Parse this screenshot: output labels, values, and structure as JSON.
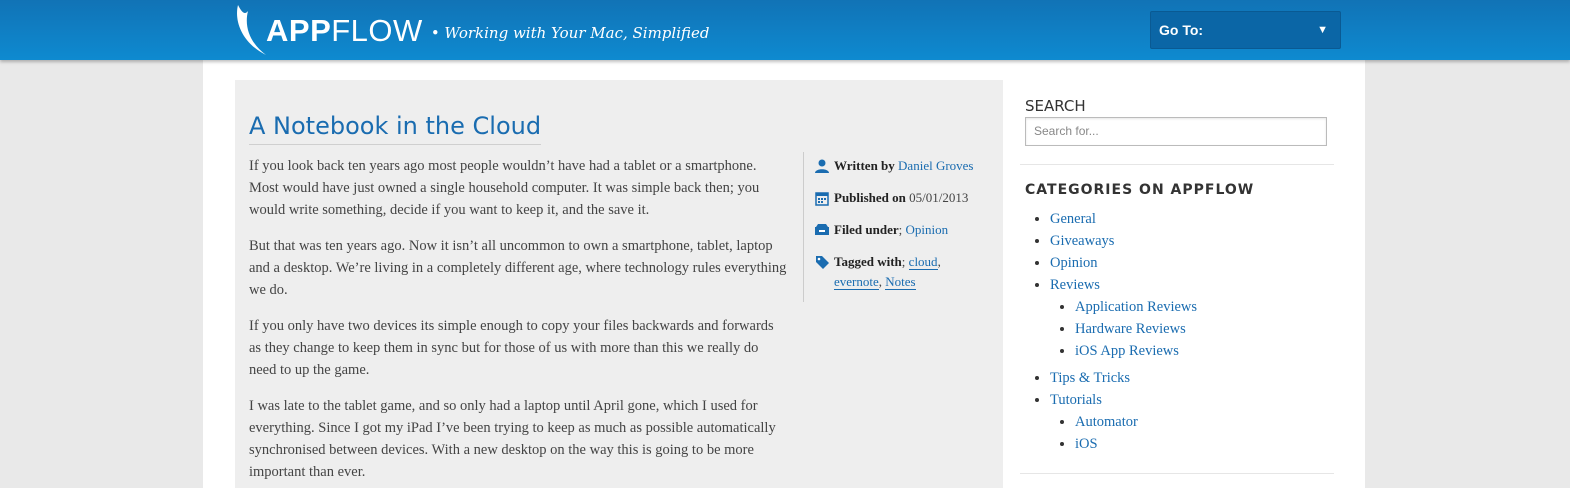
{
  "header": {
    "logo_app": "APP",
    "logo_flow": "FLOW",
    "tagline": "• Working with Your Mac, Simplified",
    "goto_label": "Go To:",
    "goto_arrow": "▼"
  },
  "article": {
    "title": "A Notebook in the Cloud",
    "paragraphs": [
      "If you look back ten years ago most people wouldn’t have had a tablet or a smartphone. Most would have just owned a single household computer. It was simple back then; you would write something, decide if you want to keep it, and the save it.",
      "But that was ten years ago. Now it isn’t all uncommon to own a smartphone, tablet, laptop and a desktop. We’re living in a completely different age, where technology rules everything we do.",
      "If you only have two devices its simple enough to copy your files backwards and forwards as they change to keep them in sync but for those of us with more than this we really do need to up the game.",
      "I was late to the tablet game, and so only had a laptop until April gone, which I used for everything. Since I got my iPad I’ve been trying to keep as much as possible automatically synchronised between devices. With a new desktop on the way this is going to be more important than ever."
    ],
    "meta": {
      "written_label": "Written by",
      "author": "Daniel Groves",
      "published_label": "Published on",
      "date": "05/01/2013",
      "filed_label": "Filed under",
      "filed_sep": ";",
      "category": "Opinion",
      "tagged_label": "Tagged with",
      "tagged_sep": ";",
      "tags": [
        "cloud",
        "evernote",
        "Notes"
      ]
    }
  },
  "sidebar": {
    "search_heading": "SEARCH",
    "search_placeholder": "Search for...",
    "categories_heading": "CATEGORIES ON APPFLOW",
    "categories": [
      "General",
      "Giveaways",
      "Opinion",
      "Reviews",
      "Application Reviews",
      "Hardware Reviews",
      "iOS App Reviews",
      "Tips & Tricks",
      "Tutorials",
      "Automator",
      "iOS"
    ]
  },
  "colors": {
    "header_top": "#1173b6",
    "header_bottom": "#0e8ad0",
    "link": "#1a6cb0"
  }
}
